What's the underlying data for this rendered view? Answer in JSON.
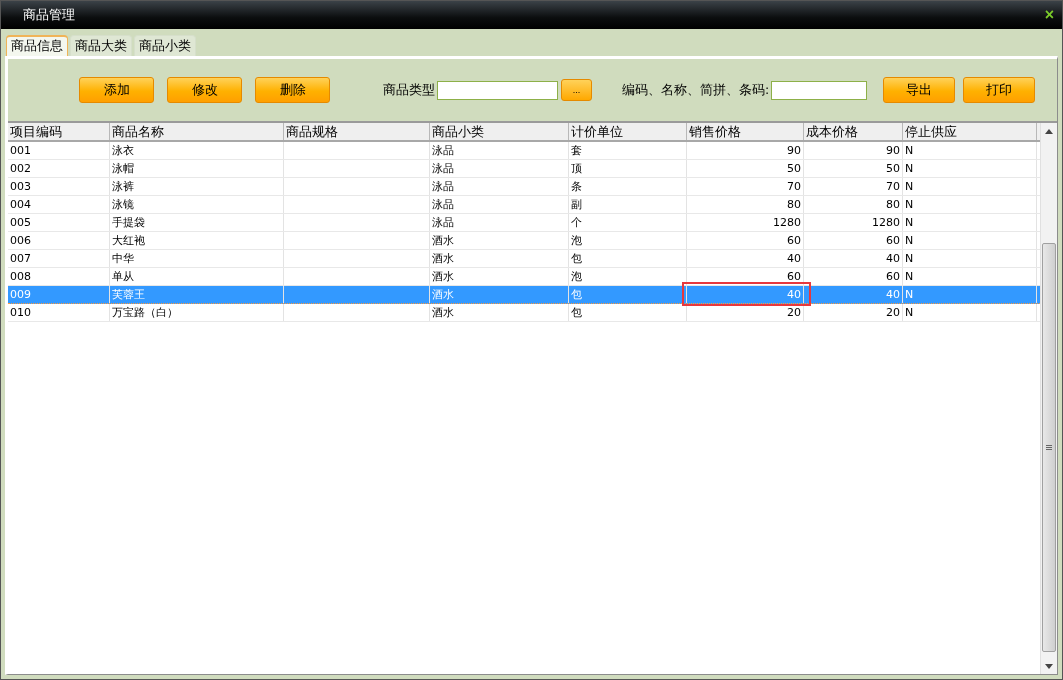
{
  "window": {
    "title": "商品管理",
    "close": "×"
  },
  "tabs": [
    {
      "label": "商品信息",
      "selected": true
    },
    {
      "label": "商品大类",
      "selected": false
    },
    {
      "label": "商品小类",
      "selected": false
    }
  ],
  "toolbar": {
    "buttons_left": [
      "添加",
      "修改",
      "删除"
    ],
    "type_label": "商品类型",
    "type_picker": "...",
    "search_label": "编码、名称、简拼、条码:",
    "buttons_right": [
      "导出",
      "打印"
    ]
  },
  "table": {
    "columns": [
      {
        "label": "项目编码",
        "kind": "text",
        "outlined": false
      },
      {
        "label": "商品名称",
        "kind": "text",
        "outlined": false
      },
      {
        "label": "商品规格",
        "kind": "text",
        "outlined": false
      },
      {
        "label": "商品小类",
        "kind": "text",
        "outlined": false
      },
      {
        "label": "计价单位",
        "kind": "text",
        "outlined": false
      },
      {
        "label": "销售价格",
        "kind": "number",
        "outlined": true
      },
      {
        "label": "成本价格",
        "kind": "number",
        "outlined": false
      },
      {
        "label": "停止供应",
        "kind": "text",
        "outlined": false
      }
    ],
    "rows": [
      {
        "cells": [
          "001",
          "泳衣",
          "",
          "泳品",
          "套",
          "90",
          "90",
          "N"
        ],
        "selected": false,
        "outlined": false
      },
      {
        "cells": [
          "002",
          "泳帽",
          "",
          "泳品",
          "顶",
          "50",
          "50",
          "N"
        ],
        "selected": false,
        "outlined": false
      },
      {
        "cells": [
          "003",
          "泳裤",
          "",
          "泳品",
          "条",
          "70",
          "70",
          "N"
        ],
        "selected": false,
        "outlined": false
      },
      {
        "cells": [
          "004",
          "泳镜",
          "",
          "泳品",
          "副",
          "80",
          "80",
          "N"
        ],
        "selected": false,
        "outlined": false
      },
      {
        "cells": [
          "005",
          "手提袋",
          "",
          "泳品",
          "个",
          "1280",
          "1280",
          "N"
        ],
        "selected": false,
        "outlined": false
      },
      {
        "cells": [
          "006",
          "大红袍",
          "",
          "酒水",
          "泡",
          "60",
          "60",
          "N"
        ],
        "selected": false,
        "outlined": false
      },
      {
        "cells": [
          "007",
          "中华",
          "",
          "酒水",
          "包",
          "40",
          "40",
          "N"
        ],
        "selected": false,
        "outlined": false
      },
      {
        "cells": [
          "008",
          "单从",
          "",
          "酒水",
          "泡",
          "60",
          "60",
          "N"
        ],
        "selected": false,
        "outlined": false
      },
      {
        "cells": [
          "009",
          "芙蓉王",
          "",
          "酒水",
          "包",
          "40",
          "40",
          "N"
        ],
        "selected": true,
        "outlined": true
      },
      {
        "cells": [
          "010",
          "万宝路（白）",
          "",
          "酒水",
          "包",
          "20",
          "20",
          "N"
        ],
        "selected": false,
        "outlined": false
      }
    ]
  }
}
